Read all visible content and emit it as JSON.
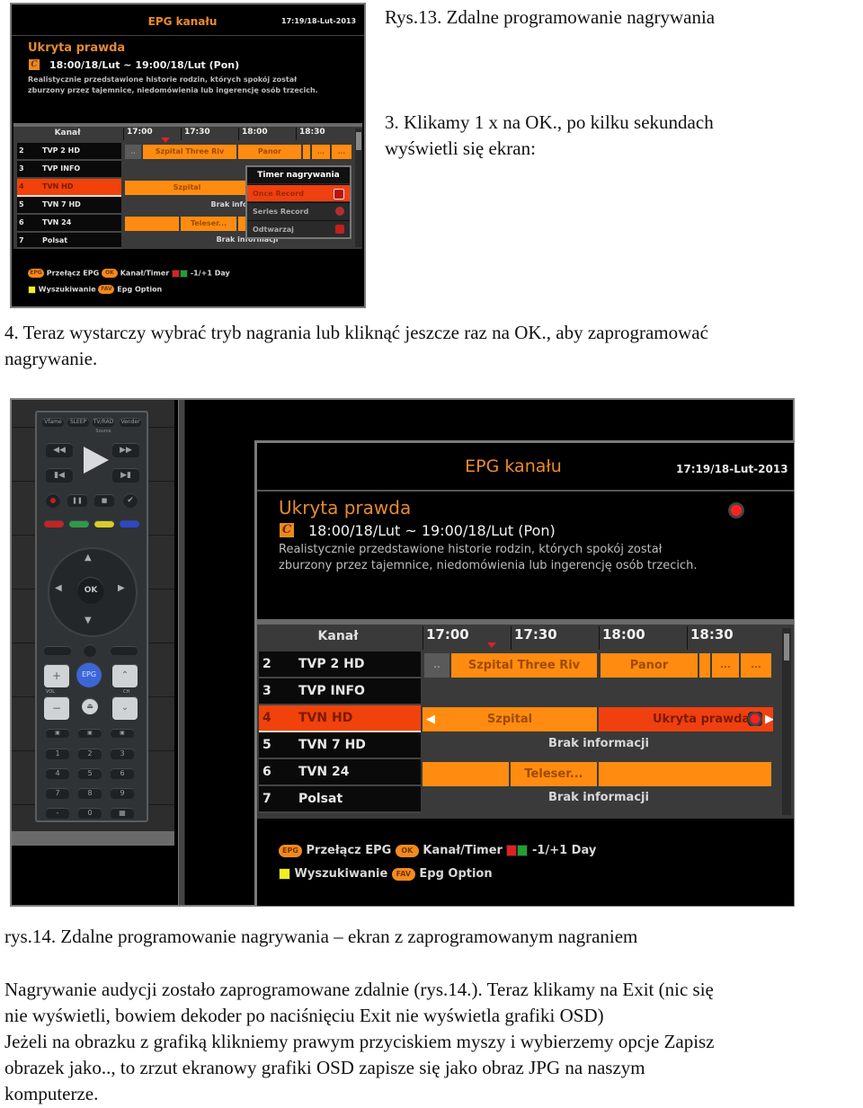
{
  "text": {
    "fig13_caption": "Rys.13. Zdalne programowanie nagrywania",
    "step3_line1": "3. Klikamy 1 x na OK., po kilku sekundach",
    "step3_line2": "wyświetli się ekran:",
    "step4_line1": "4. Teraz wystarczy wybrać tryb nagrania lub kliknąć jeszcze raz na OK., aby zaprogramować",
    "step4_line2": "nagrywanie.",
    "fig14_caption": "rys.14. Zdalne programowanie nagrywania – ekran z zaprogramowanym nagraniem",
    "para_line1": "Nagrywanie audycji zostało zaprogramowane zdalnie (rys.14.). Teraz klikamy na Exit (nic się",
    "para_line2": "nie wyświetli, bowiem dekoder po naciśnięciu Exit nie wyświetla grafiki OSD)",
    "para_line3": "Jeżeli na obrazku z grafiką klikniemy prawym przyciskiem myszy i wybierzemy opcje Zapisz",
    "para_line4": "obrazek jako.., to zrzut ekranowy grafiki OSD zapisze się jako obraz JPG na naszym",
    "para_line5": "komputerze."
  },
  "epg": {
    "title": "EPG kanału",
    "clock": "17:19/18-Lut-2013",
    "program": {
      "title": "Ukryta prawda",
      "category_icon": "C",
      "time_range": "18:00/18/Lut ~ 19:00/18/Lut (Pon)",
      "desc_line1": "Realistycznie przedstawione historie rodzin, których spokój został",
      "desc_line2": "zburzony przez tajemnice, niedomówienia lub ingerencję osób trzecich."
    },
    "grid": {
      "channel_header": "Kanał",
      "times": [
        "17:00",
        "17:30",
        "18:00",
        "18:30"
      ],
      "channels": [
        {
          "num": "2",
          "name": "TVP 2 HD"
        },
        {
          "num": "3",
          "name": "TVP INFO"
        },
        {
          "num": "4",
          "name": "TVN HD"
        },
        {
          "num": "5",
          "name": "TVN 7 HD"
        },
        {
          "num": "6",
          "name": "TVN 24"
        },
        {
          "num": "7",
          "name": "Polsat"
        }
      ],
      "selected_channel_index": 2,
      "row0": {
        "p0": "..",
        "p1": "Szpital Three Riv",
        "p2": "Panor",
        "p3": "...",
        "p4": "..."
      },
      "row2_fig1": {
        "p0": "Szpital"
      },
      "row2_fig2": {
        "p0": "Szpital",
        "p1": "Ukryta prawda"
      },
      "row3": {
        "noinfo": "Brak informacji"
      },
      "row3_fig1": {
        "noinfo": "Brak info"
      },
      "row4": {
        "p1": "Teleser..."
      },
      "row5": {
        "noinfo": "Brak informacji"
      }
    },
    "timer_menu": {
      "title": "Timer nagrywania",
      "items": [
        {
          "label": "Once Record",
          "icon": "record-once-icon",
          "selected": true
        },
        {
          "label": "Series Record",
          "icon": "record-series-icon",
          "selected": false
        },
        {
          "label": "Odtwarzaj",
          "icon": "play-icon",
          "selected": false
        }
      ]
    },
    "legend": {
      "epg_key": "EPG",
      "epg_label": "Przełącz EPG",
      "ok_key": "OK",
      "ok_label": "Kanał/Timer",
      "day_label": "-1/+1 Day",
      "search_label": "Wyszukiwanie",
      "fav_key": "FAV",
      "fav_label": "Epg Option"
    },
    "colors": {
      "accent_orange": "#ff8c10",
      "selected_red": "#f04010",
      "title_orange": "#ef8a2a",
      "key_red": "#e02020",
      "key_green": "#20a030",
      "key_yellow": "#f0f020"
    }
  },
  "remote": {
    "top_keys": [
      "Vfame",
      "SLEEP",
      "TV/RAD",
      "Vender"
    ],
    "source_label": "Source",
    "ok_label": "OK",
    "epg_label": "EPG",
    "vol_label": "VOL",
    "ch_label": "CH",
    "digits": [
      "1",
      "2",
      "3",
      "4",
      "5",
      "6",
      "7",
      "8",
      "9",
      "-",
      "0",
      "▦"
    ]
  }
}
